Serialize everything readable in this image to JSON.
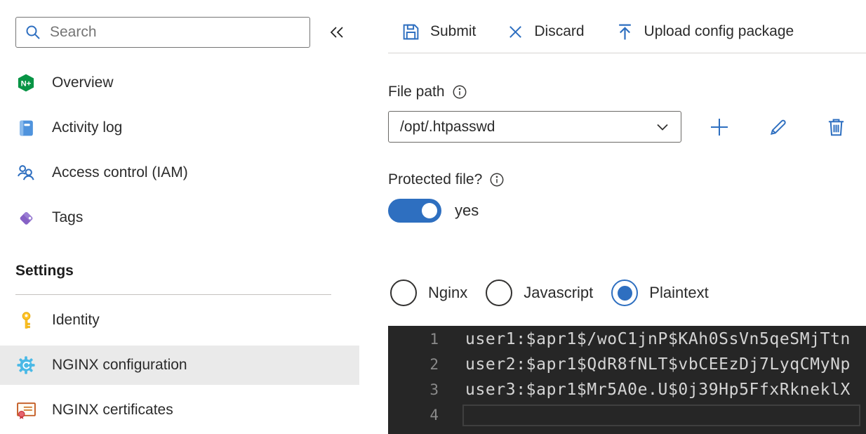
{
  "sidebar": {
    "search": {
      "placeholder": "Search"
    },
    "items": [
      {
        "label": "Overview",
        "icon": "nginx-logo-icon"
      },
      {
        "label": "Activity log",
        "icon": "activity-log-icon"
      },
      {
        "label": "Access control (IAM)",
        "icon": "access-control-icon"
      },
      {
        "label": "Tags",
        "icon": "tag-icon"
      }
    ],
    "settings_header": "Settings",
    "settings_items": [
      {
        "label": "Identity",
        "icon": "key-icon",
        "selected": false
      },
      {
        "label": "NGINX configuration",
        "icon": "gear-icon",
        "selected": true
      },
      {
        "label": "NGINX certificates",
        "icon": "certificate-icon",
        "selected": false
      }
    ]
  },
  "toolbar": {
    "submit_label": "Submit",
    "discard_label": "Discard",
    "upload_label": "Upload config package"
  },
  "main": {
    "file_path": {
      "label": "File path",
      "value": "/opt/.htpasswd"
    },
    "protected_file": {
      "label": "Protected file?",
      "state": "yes",
      "toggle_on": true
    },
    "format_options": [
      {
        "label": "Nginx",
        "selected": false
      },
      {
        "label": "Javascript",
        "selected": false
      },
      {
        "label": "Plaintext",
        "selected": true
      }
    ],
    "editor": {
      "lines": [
        {
          "number": 1,
          "text": "user1:$apr1$/woC1jnP$KAh0SsVn5qeSMjTtn"
        },
        {
          "number": 2,
          "text": "user2:$apr1$QdR8fNLT$vbCEEzDj7LyqCMyNp"
        },
        {
          "number": 3,
          "text": "user3:$apr1$Mr5A0e.U$0j39Hp5FfxRkneklX"
        },
        {
          "number": 4,
          "text": ""
        }
      ]
    }
  },
  "colors": {
    "accent_blue": "#2e6fc0",
    "nginx_green": "#089445",
    "tag_purple": "#8661c5",
    "key_gold": "#ffc327",
    "gear_blue": "#4ab9e6",
    "selected_row_bg": "#eaeaea",
    "editor_bg": "#262626",
    "editor_text": "#d4d4d4"
  }
}
